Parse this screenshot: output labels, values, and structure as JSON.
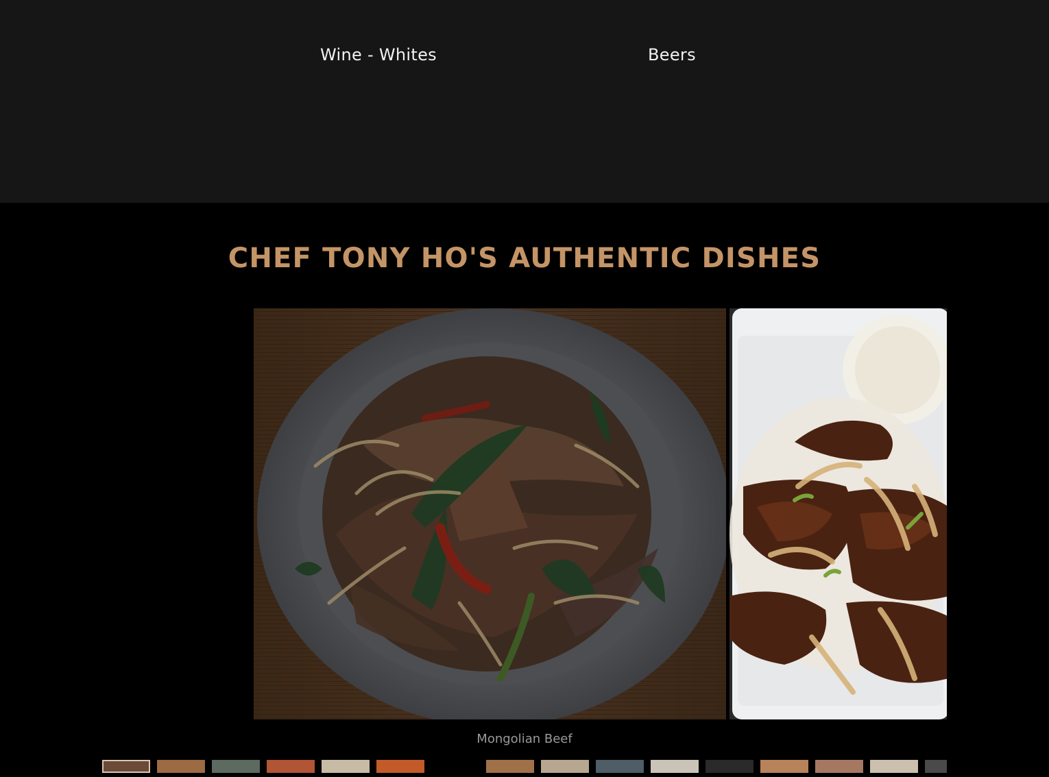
{
  "menu_categories": [
    {
      "label": "Wine - Whites"
    },
    {
      "label": "Beers"
    }
  ],
  "dishes_section": {
    "title": "CHEF TONY HO'S AUTHENTIC DISHES",
    "current_caption": "Mongolian Beef",
    "slides": [
      {
        "kind": "image",
        "subject": "stir-fried beef with noodles and greens on a white plate"
      },
      {
        "kind": "image",
        "subject": "beef with onions and white rice on a rectangular plate"
      }
    ],
    "thumbnails": [
      {
        "color": "#6b4a38",
        "active": true
      },
      {
        "color": "#9c6a43"
      },
      {
        "color": "#5c6a60"
      },
      {
        "color": "#b25436"
      },
      {
        "color": "#c8bba6"
      },
      {
        "color": "#c35a2a"
      },
      {
        "color": "#000000"
      },
      {
        "color": "#a07048"
      },
      {
        "color": "#b7a690"
      },
      {
        "color": "#4e5d66"
      },
      {
        "color": "#c9c3b8"
      },
      {
        "color": "#2a2a2a"
      },
      {
        "color": "#b8835a"
      },
      {
        "color": "#a67862"
      },
      {
        "color": "#cbbfae"
      },
      {
        "color": "#4a4a4a"
      }
    ]
  },
  "colors": {
    "top_band": "#161616",
    "section_bg": "#000000",
    "title_accent": "#c49467",
    "caption": "#9a9a9a"
  }
}
